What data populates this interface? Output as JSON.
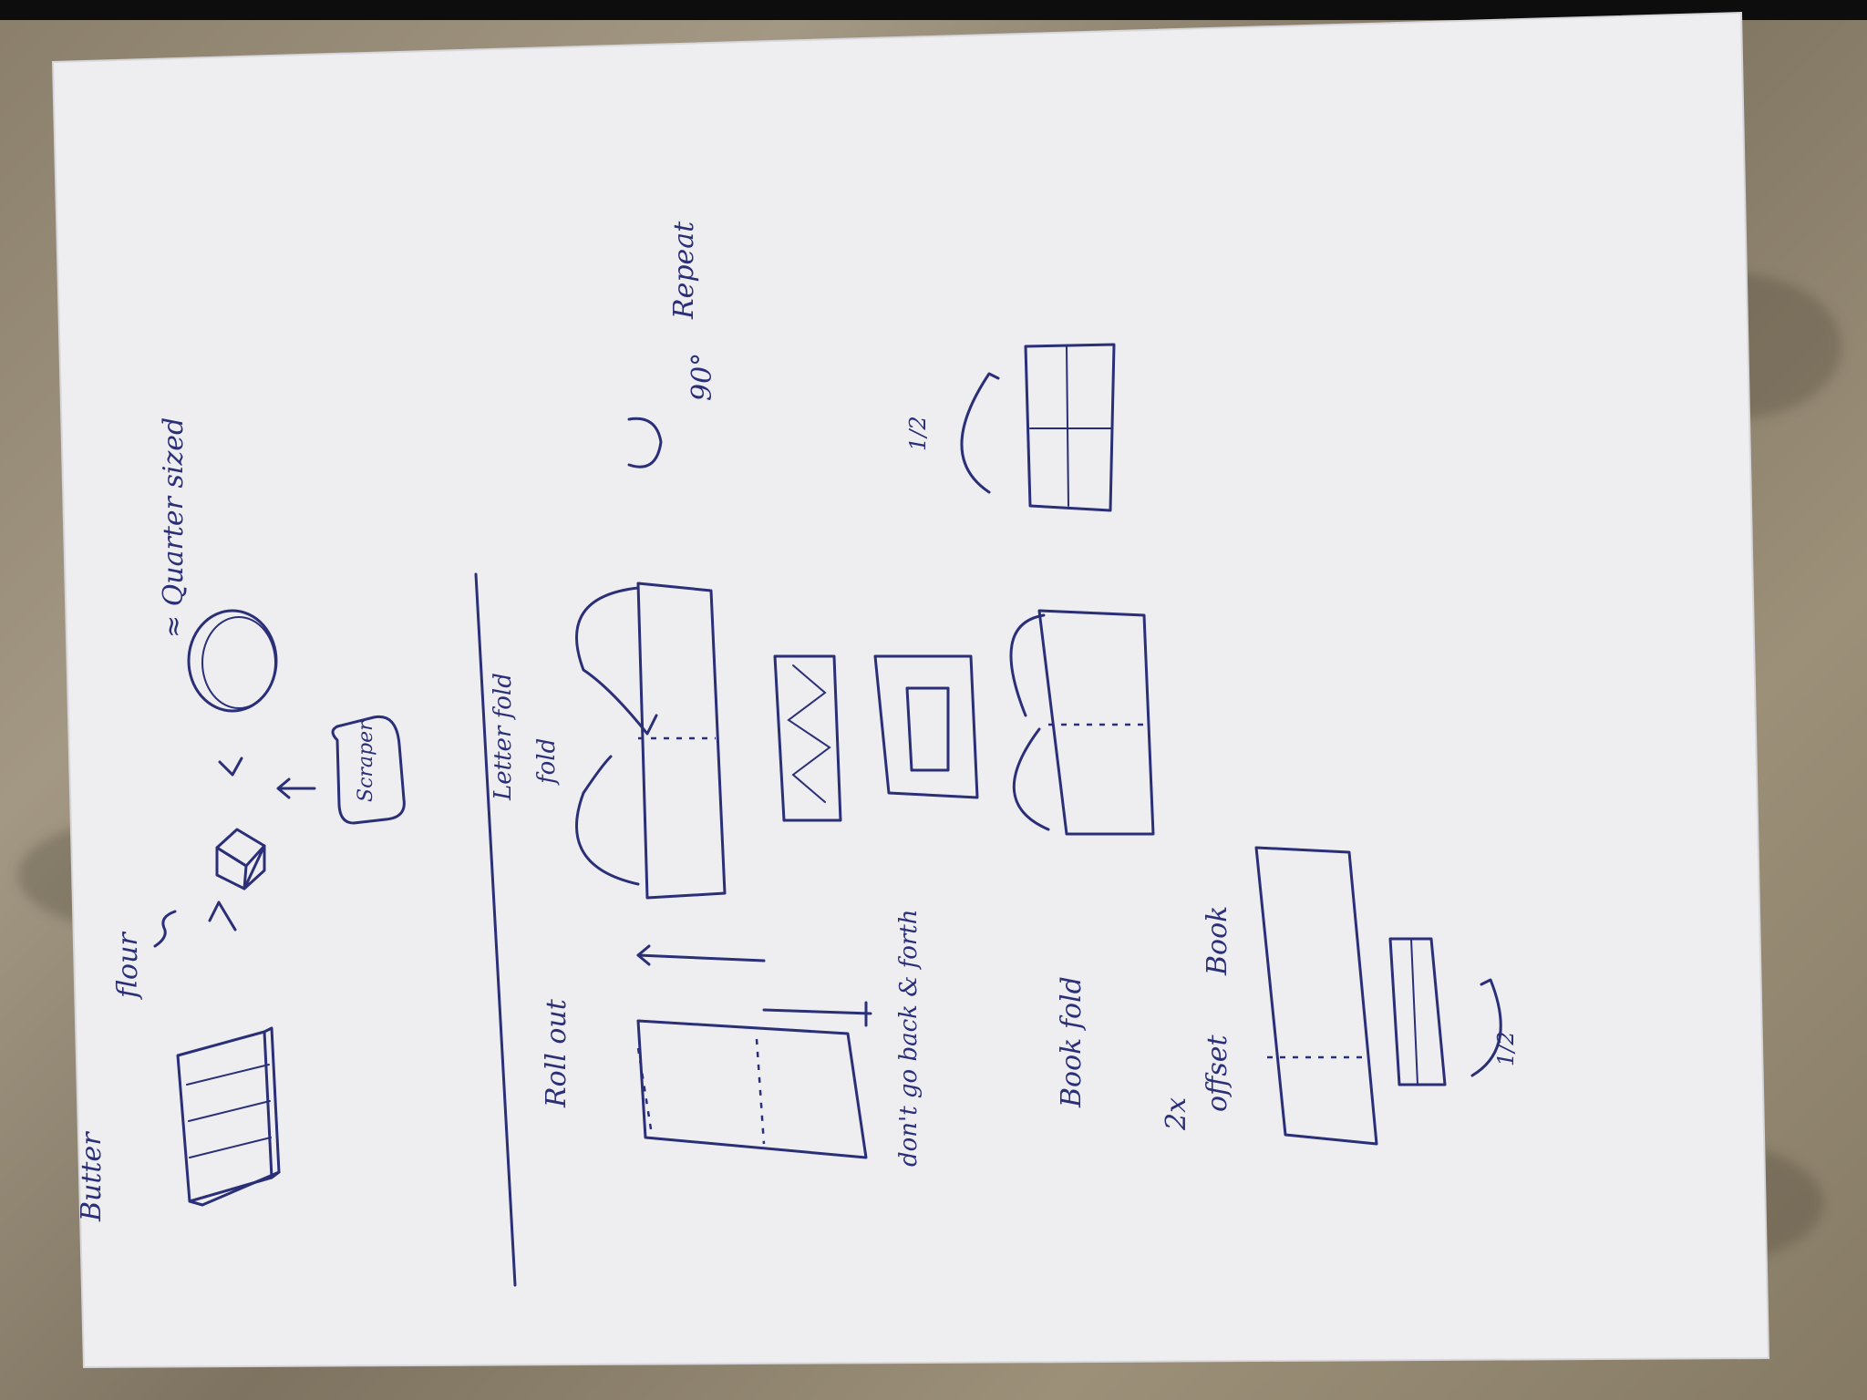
{
  "labels": {
    "butter": "Butter",
    "flour": "flour",
    "quarter_sized": "≈ Quarter sized",
    "scraper": "Scraper",
    "letter_fold": "Letter fold",
    "book_fold_scribble": "Book",
    "fold_word": "fold",
    "turn_90": "90°",
    "repeat": "Repeat",
    "half_top": "1/2",
    "roll_out": "Roll out",
    "dont_go_back_forth": "don't go back & forth",
    "book_fold": "Book fold",
    "two_x": "2x",
    "offset": "offset",
    "book": "Book",
    "half_bottom": "1/2"
  }
}
